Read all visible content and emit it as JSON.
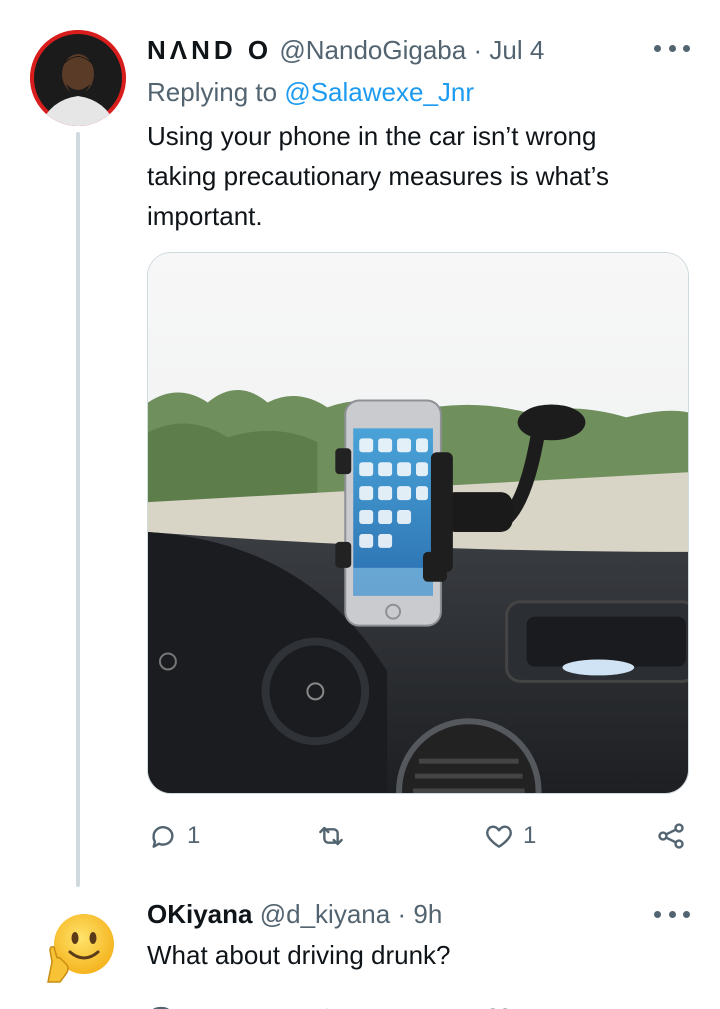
{
  "tweet1": {
    "display_name": "NΛND O",
    "handle": "@NandoGigaba",
    "separator": "·",
    "time": "Jul 4",
    "replying_prefix": "Replying to",
    "replying_to": "@Salawexe_Jnr",
    "text_lines": [
      "Using your phone in the car isn’t wrong",
      "taking precautionary measures is what’s",
      "important."
    ],
    "actions": {
      "reply_count": "1",
      "retweet_count": "",
      "like_count": "1"
    }
  },
  "tweet2": {
    "display_name": "OKiyana",
    "handle": "@d_kiyana",
    "separator": "·",
    "time": "9h",
    "text": "What about driving drunk?"
  },
  "colors": {
    "accent": "#1d9bf0",
    "secondary_text": "#536471",
    "thread_line": "#cfd9de"
  },
  "icons": [
    "more-icon",
    "reply-icon",
    "retweet-icon",
    "like-icon",
    "share-icon"
  ]
}
